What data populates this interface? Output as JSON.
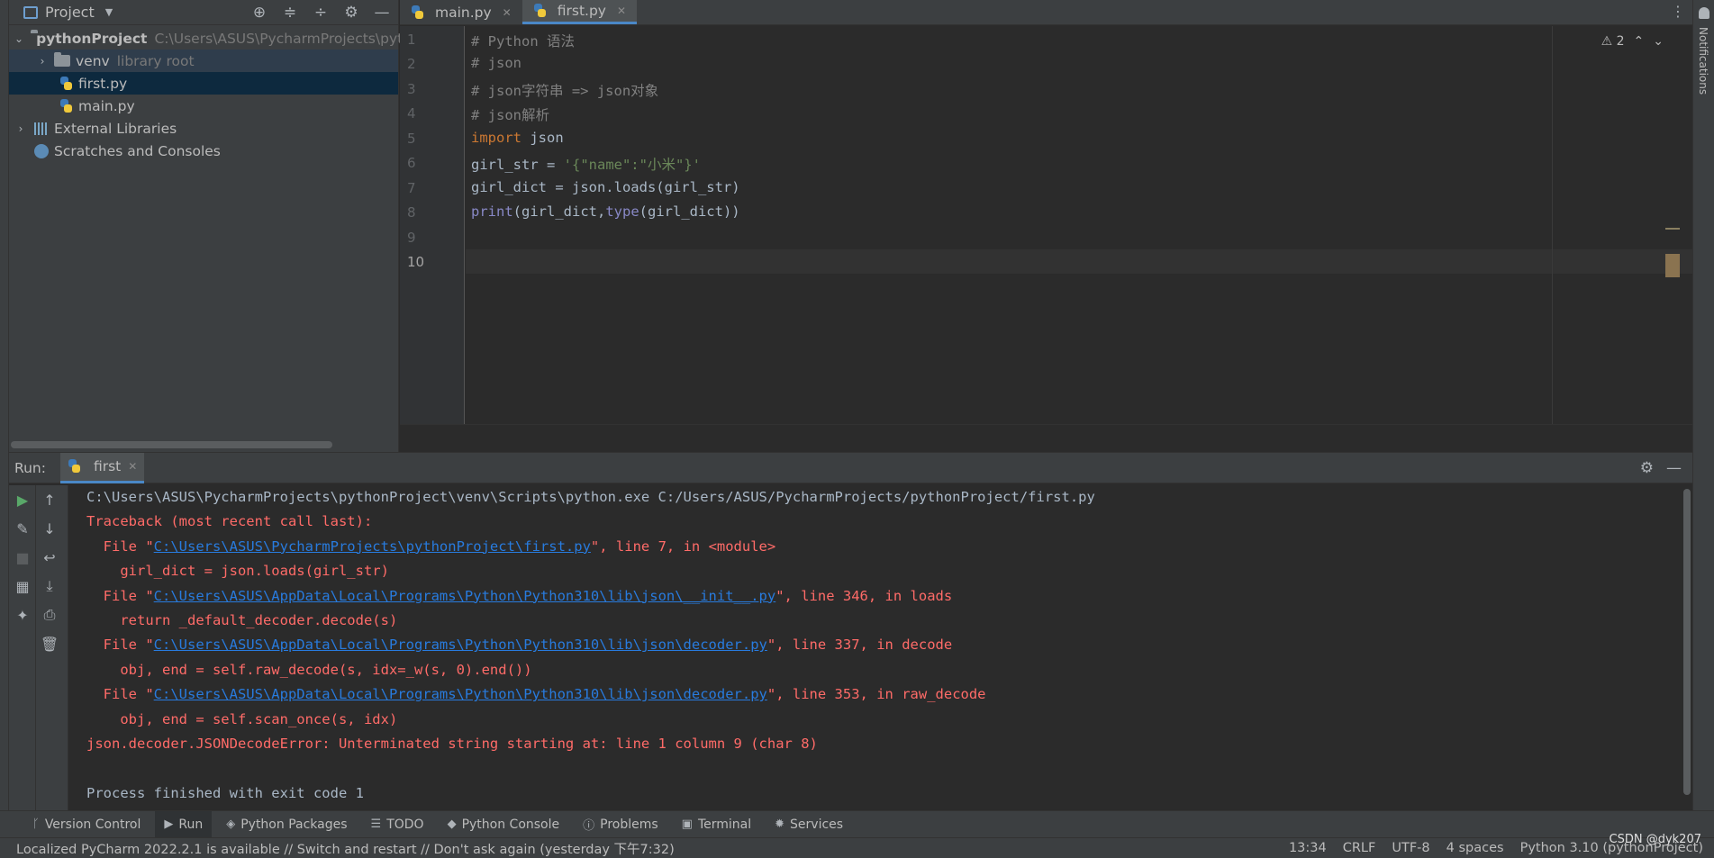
{
  "project_panel": {
    "title": "Project",
    "tree": {
      "root_name": "pythonProject",
      "root_path": "C:\\Users\\ASUS\\PycharmProjects\\pyt",
      "venv": "venv",
      "venv_note": "library root",
      "file_first": "first.py",
      "file_main": "main.py",
      "external_libs": "External Libraries",
      "scratches": "Scratches and Consoles"
    }
  },
  "editor": {
    "tabs": [
      "main.py",
      "first.py"
    ],
    "active_tab": "first.py",
    "warning_count": "2",
    "line_numbers": [
      "1",
      "2",
      "3",
      "4",
      "5",
      "6",
      "7",
      "8",
      "9",
      "10"
    ],
    "code": {
      "l1": "# Python 语法",
      "l2": "# json",
      "l3": "# json字符串 => json对象",
      "l4": "# json解析",
      "l5_kw": "import",
      "l5_rest": " json",
      "l6_a": "girl_str = ",
      "l6_str": "'{\"name\":\"小米\"}'",
      "l7": "girl_dict = json.loads(girl_str)",
      "l8_print": "print",
      "l8_a": "(girl_dict,",
      "l8_type": "type",
      "l8_b": "(girl_dict))"
    }
  },
  "run_panel": {
    "label": "Run:",
    "tab": "first",
    "console": {
      "cmd": "C:\\Users\\ASUS\\PycharmProjects\\pythonProject\\venv\\Scripts\\python.exe C:/Users/ASUS/PycharmProjects/pythonProject/first.py",
      "traceback": "Traceback (most recent call last):",
      "f1_pre": "  File \"",
      "f1_link": "C:\\Users\\ASUS\\PycharmProjects\\pythonProject\\first.py",
      "f1_post": "\", line 7, in <module>",
      "c1": "    girl_dict = json.loads(girl_str)",
      "f2_pre": "  File \"",
      "f2_link": "C:\\Users\\ASUS\\AppData\\Local\\Programs\\Python\\Python310\\lib\\json\\__init__.py",
      "f2_post": "\", line 346, in loads",
      "c2": "    return _default_decoder.decode(s)",
      "f3_pre": "  File \"",
      "f3_link": "C:\\Users\\ASUS\\AppData\\Local\\Programs\\Python\\Python310\\lib\\json\\decoder.py",
      "f3_post": "\", line 337, in decode",
      "c3": "    obj, end = self.raw_decode(s, idx=_w(s, 0).end())",
      "f4_pre": "  File \"",
      "f4_link": "C:\\Users\\ASUS\\AppData\\Local\\Programs\\Python\\Python310\\lib\\json\\decoder.py",
      "f4_post": "\", line 353, in raw_decode",
      "c4": "    obj, end = self.scan_once(s, idx)",
      "error": "json.decoder.JSONDecodeError: Unterminated string starting at: line 1 column 9 (char 8)",
      "finished": "Process finished with exit code 1"
    }
  },
  "bottom_tabs": [
    "Version Control",
    "Run",
    "Python Packages",
    "TODO",
    "Python Console",
    "Problems",
    "Terminal",
    "Services"
  ],
  "status_bar": {
    "message": "Localized PyCharm 2022.2.1 is available // Switch and restart // Don't ask again (yesterday 下午7:32)",
    "position": "13:34",
    "line_sep": "CRLF",
    "encoding": "UTF-8",
    "indent": "4 spaces",
    "interpreter": "Python 3.10 (pythonProject)"
  },
  "right_strip_label": "Notifications",
  "watermark": "CSDN @dyk207"
}
